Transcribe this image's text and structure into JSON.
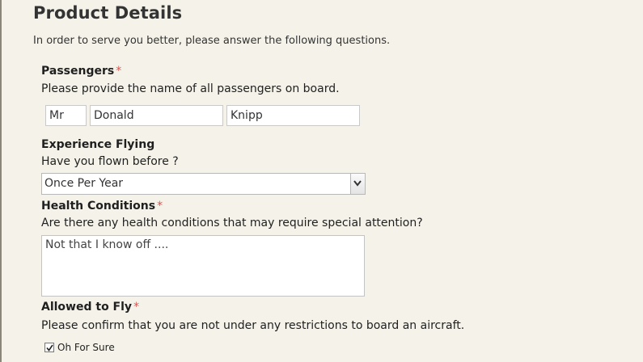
{
  "section": {
    "title": "Product Details",
    "intro": "In order to serve you better, please answer the following questions."
  },
  "passengers": {
    "label": "Passengers",
    "required_mark": "*",
    "help": "Please provide the name of all passengers on board.",
    "title_value": "Mr",
    "first_name_value": "Donald",
    "last_name_value": "Knipp"
  },
  "experience": {
    "label": "Experience Flying",
    "help": "Have you flown before ?",
    "selected": "Once Per Year",
    "arrow_icon": "chevron-down-icon"
  },
  "health": {
    "label": "Health Conditions",
    "required_mark": "*",
    "help": "Are there any health conditions that may require special attention?",
    "value": "Not that I know off ...."
  },
  "allowed": {
    "label": "Allowed to Fly",
    "required_mark": "*",
    "help": "Please confirm that you are not under any restrictions to board an aircraft.",
    "checkbox_label": "Oh For Sure",
    "checked": true
  },
  "colors": {
    "background": "#f5f3e9",
    "required": "#e05050"
  }
}
